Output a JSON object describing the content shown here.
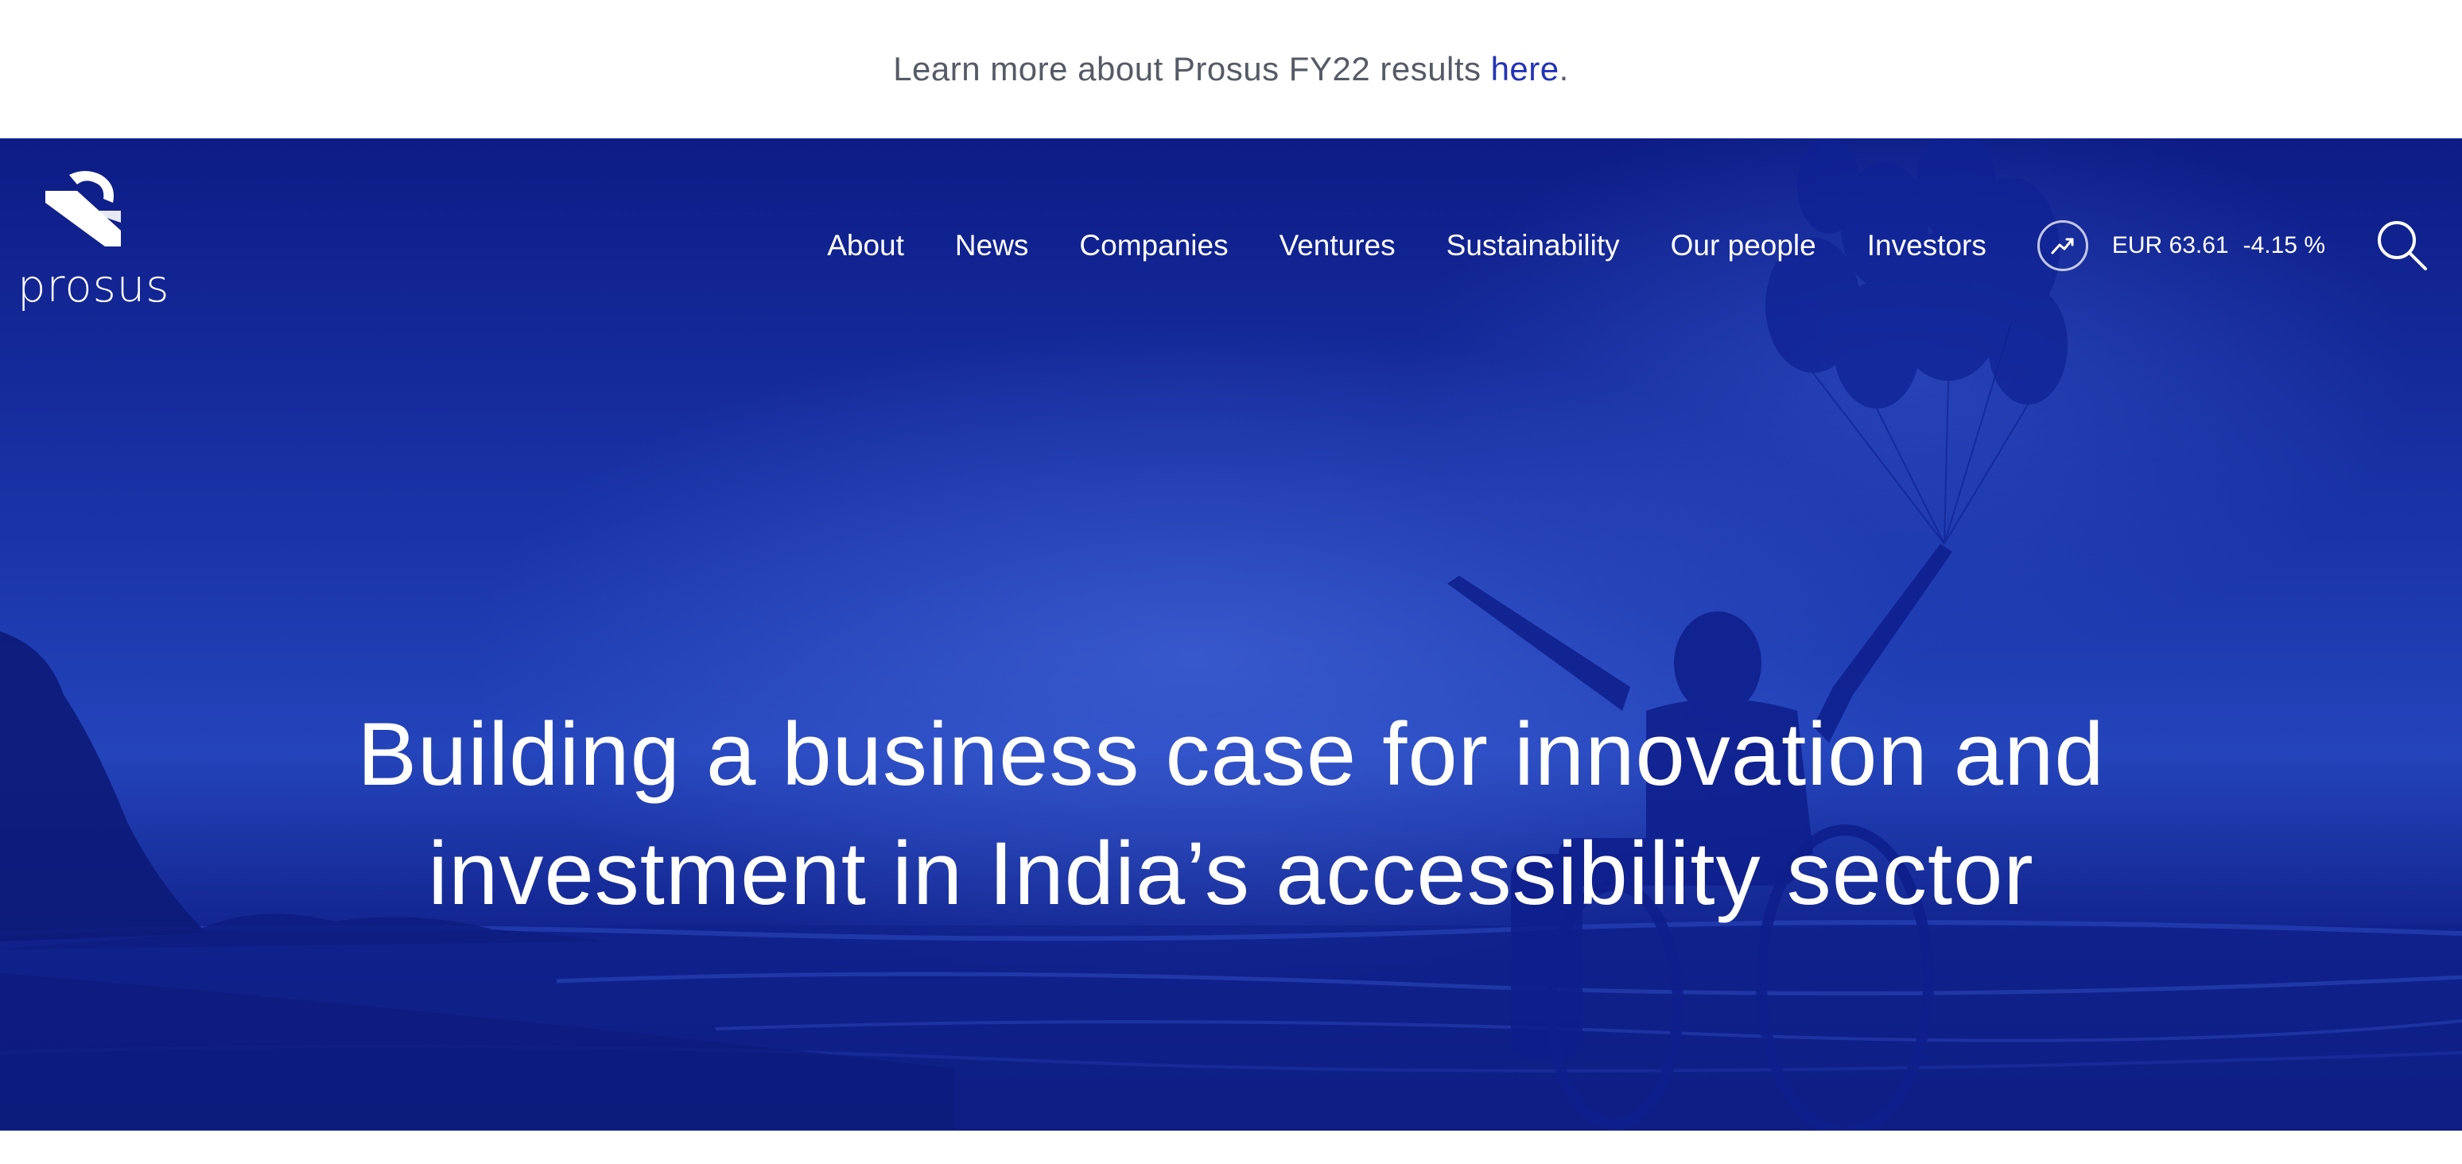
{
  "announcement": {
    "text": "Learn more about Prosus FY22 results",
    "link_label": "here",
    "period": "."
  },
  "brand": {
    "name": "prosus",
    "logo_icon": "prosus-logo-icon"
  },
  "nav": {
    "items": [
      {
        "label": "About"
      },
      {
        "label": "News"
      },
      {
        "label": "Companies"
      },
      {
        "label": "Ventures"
      },
      {
        "label": "Sustainability"
      },
      {
        "label": "Our people"
      },
      {
        "label": "Investors"
      }
    ]
  },
  "stock": {
    "icon": "trend-up-icon",
    "price": "EUR 63.61",
    "change": "-4.15 %"
  },
  "search": {
    "icon": "search-icon"
  },
  "hero": {
    "title_line1": "Building a business case for innovation and",
    "title_line2": "investment in India’s accessibility sector"
  },
  "colors": {
    "hero_blue": "#1a34a8",
    "link_blue": "#2133b8",
    "text_gray": "#555b66",
    "white": "#ffffff"
  }
}
